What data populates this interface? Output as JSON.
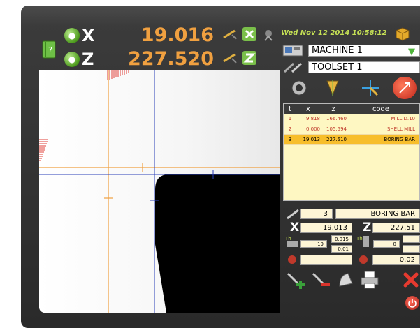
{
  "header": {
    "datetime": "Wed Nov 12 2014 10:58:12"
  },
  "axes": {
    "x": {
      "letter": "X",
      "value": "19.016"
    },
    "z": {
      "letter": "Z",
      "value": "227.520"
    }
  },
  "selectors": {
    "machine": "MACHINE 1",
    "toolset": "TOOLSET 1"
  },
  "tool_table": {
    "columns": [
      "t",
      "x",
      "z",
      "code"
    ],
    "rows": [
      {
        "t": "1",
        "x": "9.818",
        "z": "166.460",
        "code": "MILL D.10"
      },
      {
        "t": "2",
        "x": "0.000",
        "z": "105.594",
        "code": "SHELL MILL"
      },
      {
        "t": "3",
        "x": "19.013",
        "z": "227.510",
        "code": "BORING BAR"
      }
    ],
    "selected_index": 2
  },
  "tool_detail": {
    "number": "3",
    "name": "BORING BAR",
    "x_label": "X",
    "z_label": "Z",
    "x_value": "19.013",
    "z_value": "227.51",
    "th_left_main": "19",
    "th_left_plus": "0.015",
    "th_left_minus": "0.01",
    "th_right_main": "0",
    "radius": "0.02"
  },
  "colors": {
    "axis_value": "#f0a040",
    "datetime": "#c5e055",
    "row_selected": "#f7be2c",
    "table_bg": "#fef7c2",
    "crosshair_orange": "#f0a040",
    "crosshair_blue": "#2a3fb8",
    "close_red": "#e53a2f",
    "power_red": "#d9332b"
  },
  "icons": {
    "book": "book-icon",
    "lock": "lock-icon",
    "cube": "cube-icon",
    "machine": "machine-icon",
    "toolset": "toolset-icon",
    "add_tool": "add-tool-icon",
    "delete_tool": "delete-tool-icon",
    "printer": "printer-icon",
    "close": "close-icon",
    "power": "power-icon"
  }
}
